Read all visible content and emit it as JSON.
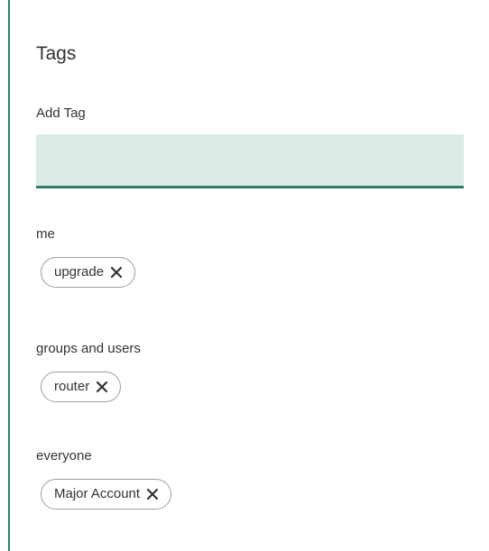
{
  "section": {
    "title": "Tags"
  },
  "add_tag": {
    "label": "Add Tag",
    "value": "",
    "placeholder": ""
  },
  "groups": [
    {
      "label": "me",
      "tags": [
        "upgrade"
      ]
    },
    {
      "label": "groups and users",
      "tags": [
        "router"
      ]
    },
    {
      "label": "everyone",
      "tags": [
        "Major Account"
      ]
    }
  ],
  "icons": {
    "remove": "close-icon"
  },
  "colors": {
    "accent": "#2e7d6a",
    "input_background": "#dcebe6",
    "chip_border": "#9e9e9e",
    "text": "#333333"
  }
}
